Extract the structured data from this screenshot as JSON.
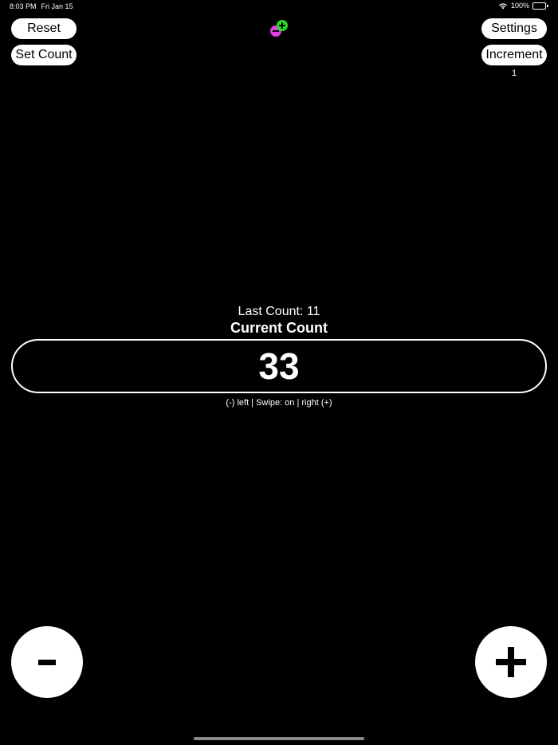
{
  "status_bar": {
    "time": "8:03 PM",
    "date": "Fri Jan 15",
    "battery": "100%"
  },
  "toolbar": {
    "reset_label": "Reset",
    "set_count_label": "Set Count",
    "settings_label": "Settings",
    "increment_label": "Increment",
    "increment_value": "1"
  },
  "logo": {
    "minus_color": "#e040e0",
    "plus_color": "#22dd22"
  },
  "counter": {
    "last_count_label": "Last Count:",
    "last_count_value": "11",
    "current_count_label": "Current Count",
    "current_count_value": "33",
    "swipe_hint": "(-) left | Swipe: on | right (+)"
  },
  "controls": {
    "minus_icon": "minus-icon",
    "plus_icon": "plus-icon"
  }
}
